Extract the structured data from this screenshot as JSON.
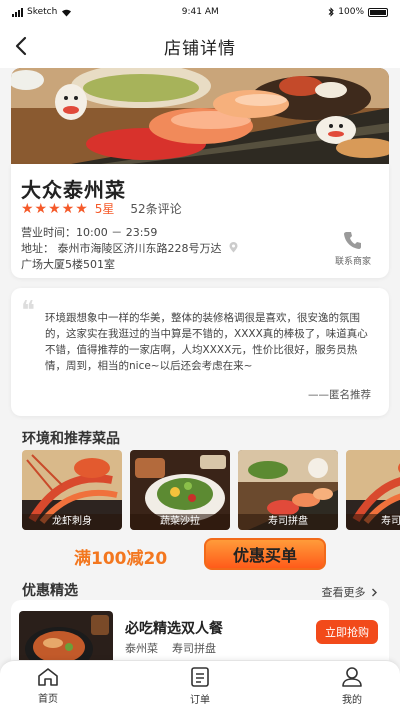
{
  "status": {
    "carrier": "Sketch",
    "time": "9:41 AM",
    "battery": "100%"
  },
  "nav": {
    "title": "店铺详情"
  },
  "shop": {
    "name": "大众泰州菜",
    "stars": "★★★★★",
    "star_text": "5星",
    "review_count": "52条评论",
    "hours": "营业时间：10:00 － 23:59",
    "address_line1": "地址： 泰州市海陵区济川东路228号万达",
    "address_line2": "广场大厦5楼501室",
    "contact_label": "联系商家"
  },
  "review": {
    "text": "环境跟想象中一样的华美，整体的装修格调很是喜欢，很安逸的氛围的，这家实在我逛过的当中算是不错的，XXXX真的棒极了，味道真心不错，值得推荐的一家店啊，人均XXXX元，性价比很好，服务员热情，周到，相当的nice~以后还会考虑在来~",
    "signature": "——匿名推荐"
  },
  "dishes_section": {
    "title": "环境和推荐菜品"
  },
  "dishes": [
    {
      "name": "龙虾刺身"
    },
    {
      "name": "蔬菜沙拉"
    },
    {
      "name": "寿司拼盘"
    },
    {
      "name": "寿司拼"
    }
  ],
  "promo": {
    "text": "满100减20",
    "button": "优惠买单"
  },
  "deals_section": {
    "title": "优惠精选",
    "more": "查看更多"
  },
  "deal": {
    "title": "必吃精选双人餐",
    "subtitle": "泰州菜    寿司拼盘",
    "button": "立即抢购"
  },
  "tabs": [
    {
      "label": "首页",
      "icon": "home-icon"
    },
    {
      "label": "订单",
      "icon": "order-icon"
    },
    {
      "label": "我的",
      "icon": "user-icon"
    }
  ],
  "colors": {
    "accent": "#f55a2a",
    "promo": "#f3771f"
  }
}
